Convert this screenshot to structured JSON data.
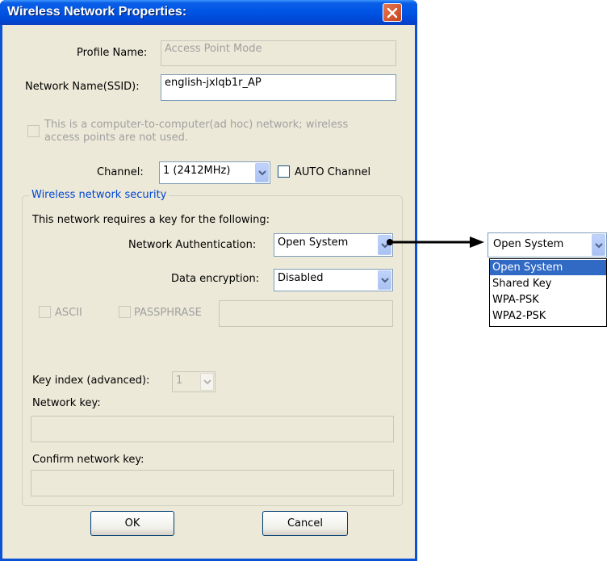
{
  "window": {
    "title": "Wireless Network Properties:"
  },
  "profile": {
    "label": "Profile Name:",
    "value": "Access Point Mode"
  },
  "ssid": {
    "label": "Network Name(SSID):",
    "value": "english-jxlqb1r_AP"
  },
  "adhoc": {
    "label": "This is a computer-to-computer(ad hoc) network; wireless access points are not used.",
    "line1": "This is a computer-to-computer(ad hoc) network; wireless",
    "line2": "access points are not used."
  },
  "channel": {
    "label": "Channel:",
    "value": "1  (2412MHz)",
    "auto_label": "AUTO Channel"
  },
  "security": {
    "group_title": "Wireless network security",
    "requires_key": "This network requires a key for the following:",
    "auth_label": "Network Authentication:",
    "auth_value": "Open System",
    "encryption_label": "Data encryption:",
    "encryption_value": "Disabled",
    "ascii_label": "ASCII",
    "passphrase_label": "PASSPHRASE",
    "key_index_label": "Key index (advanced):",
    "key_index_value": "1",
    "network_key_label": "Network key:",
    "confirm_key_label": "Confirm network key:"
  },
  "buttons": {
    "ok": "OK",
    "cancel": "Cancel"
  },
  "dropdown": {
    "selected": "Open System",
    "options": [
      "Open System",
      "Shared Key",
      "WPA-PSK",
      "WPA2-PSK"
    ]
  },
  "colors": {
    "accent": "#0a52d6",
    "selection": "#316ac5",
    "group_title": "#0046d5"
  }
}
